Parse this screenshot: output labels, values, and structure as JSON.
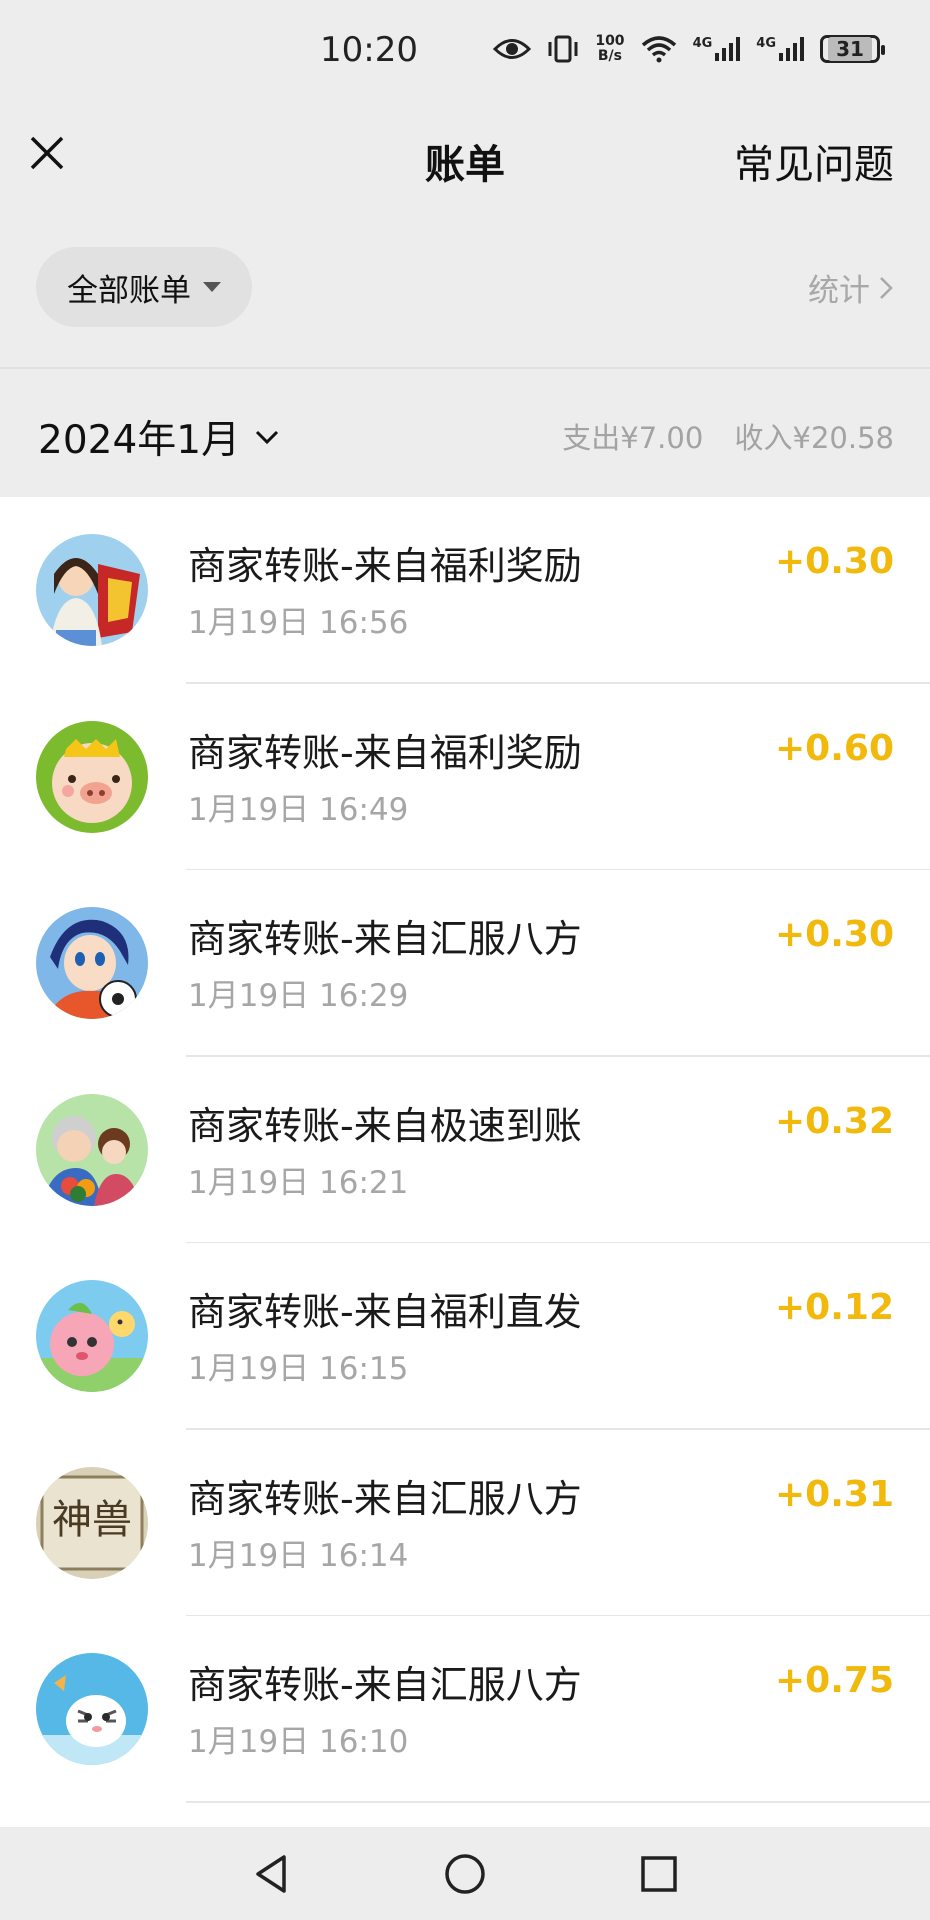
{
  "status_bar": {
    "time": "10:20",
    "net_speed_value": "100",
    "net_speed_unit": "B/s",
    "network_1": "4G",
    "network_2": "4G",
    "battery": "31",
    "icons": [
      "eye-icon",
      "vibrate-icon",
      "wifi-icon",
      "signal-icon",
      "signal-icon",
      "battery-icon"
    ]
  },
  "header": {
    "close_icon": "close-icon",
    "title": "账单",
    "faq": "常见问题"
  },
  "filter": {
    "label": "全部账单",
    "stats": "统计"
  },
  "month": {
    "label": "2024年1月",
    "expense": "支出¥7.00",
    "income": "收入¥20.58"
  },
  "transactions": [
    {
      "title": "商家转账-来自福利奖励",
      "time": "1月19日 16:56",
      "amount": "+0.30",
      "avatar": "game-avatar-girl-shield"
    },
    {
      "title": "商家转账-来自福利奖励",
      "time": "1月19日 16:49",
      "amount": "+0.60",
      "avatar": "game-avatar-pig"
    },
    {
      "title": "商家转账-来自汇服八方",
      "time": "1月19日 16:29",
      "amount": "+0.30",
      "avatar": "game-avatar-soccer-girl"
    },
    {
      "title": "商家转账-来自极速到账",
      "time": "1月19日 16:21",
      "amount": "+0.32",
      "avatar": "game-avatar-grandma"
    },
    {
      "title": "商家转账-来自福利直发",
      "time": "1月19日 16:15",
      "amount": "+0.12",
      "avatar": "game-avatar-pink-blob"
    },
    {
      "title": "商家转账-来自汇服八方",
      "time": "1月19日 16:14",
      "amount": "+0.31",
      "avatar": "game-avatar-calligraphy"
    },
    {
      "title": "商家转账-来自汇服八方",
      "time": "1月19日 16:10",
      "amount": "+0.75",
      "avatar": "game-avatar-tiger"
    }
  ],
  "avatar_art": {
    "calligraphy_text": "神兽"
  },
  "colors": {
    "amount": "#f0b90b",
    "background": "#ededed",
    "list_background": "#ffffff",
    "secondary_text": "#a6a6a6"
  },
  "nav_bar": {
    "icons": [
      "back-triangle-icon",
      "home-circle-icon",
      "recents-square-icon"
    ]
  }
}
